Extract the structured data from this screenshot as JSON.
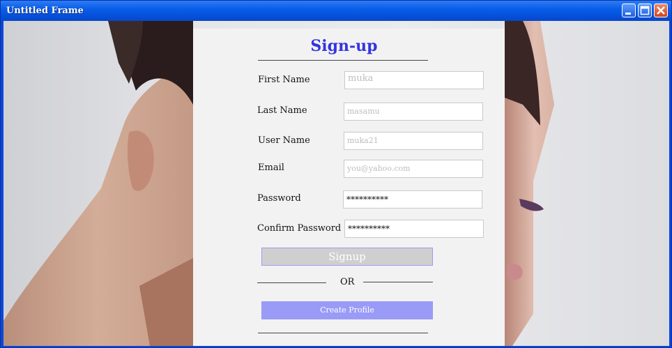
{
  "window": {
    "title": "Untitled Frame",
    "controls": [
      "minimize-icon",
      "maximize-icon",
      "close-icon"
    ]
  },
  "form": {
    "heading": "Sign-up",
    "fields": [
      {
        "label": "First Name",
        "value": "muka"
      },
      {
        "label": "Last Name",
        "value": "masamu"
      },
      {
        "label": "User Name",
        "value": "muka21"
      },
      {
        "label": "Email",
        "value": "you@yahoo.com"
      },
      {
        "label": "Password",
        "value": "**********"
      },
      {
        "label": "Confirm Password",
        "value": "**********"
      }
    ],
    "signup_label": "Signup",
    "or_label": "OR",
    "create_profile_label": "Create Profile"
  },
  "colors": {
    "heading": "#3434e0",
    "create_button": "#9a9af7",
    "signup_button": "#cfcfcf",
    "panel": "#f2f2f2"
  }
}
